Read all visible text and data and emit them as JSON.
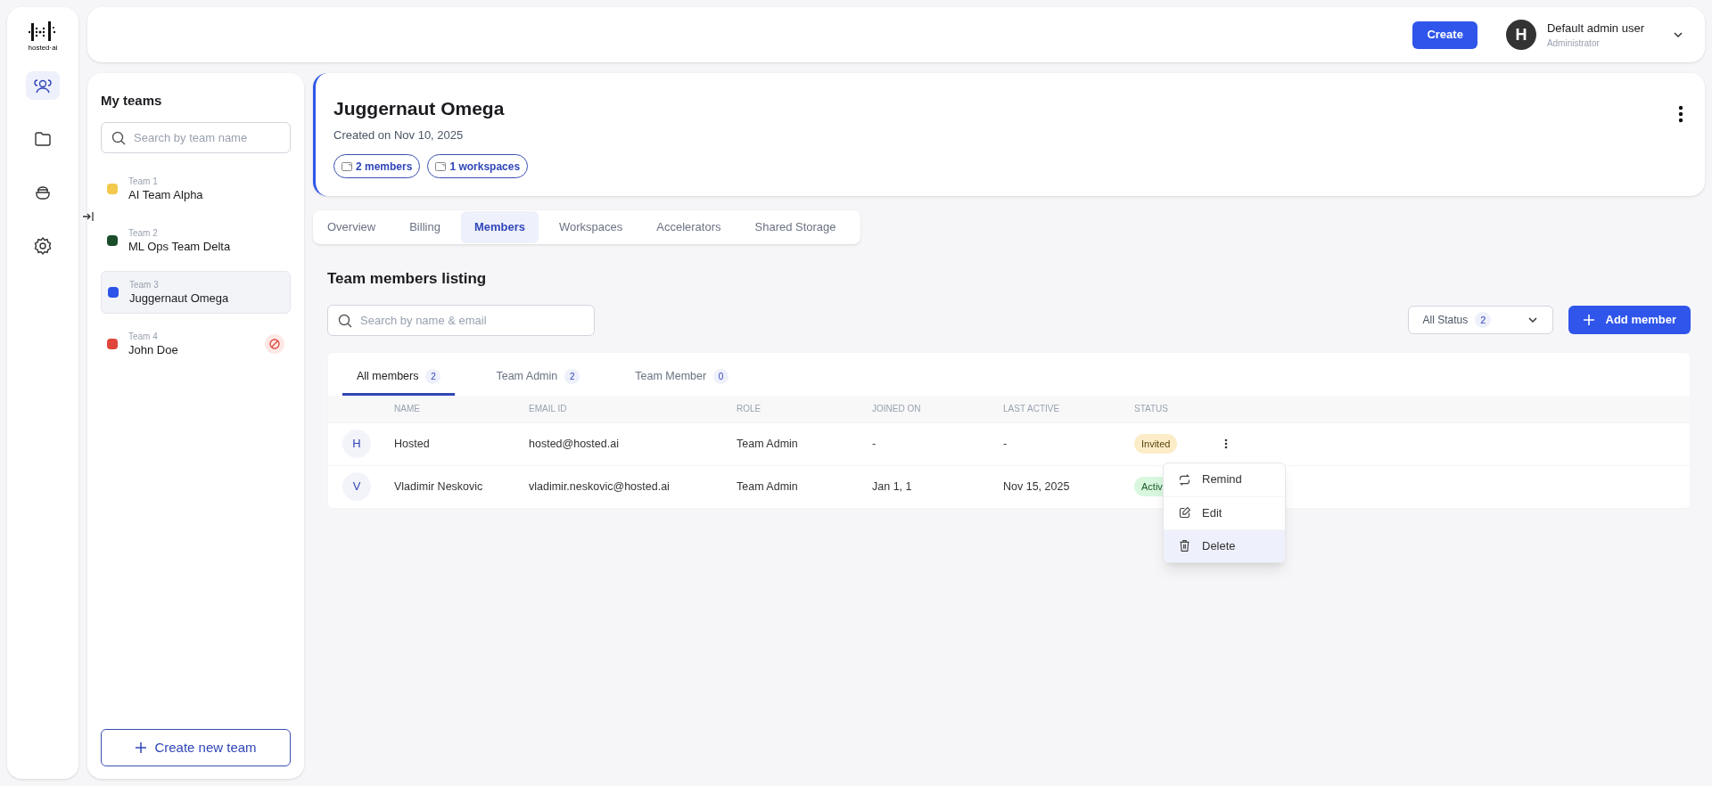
{
  "logo_text": "hosted·ai",
  "nav": [
    {
      "kind": "team",
      "selected": true
    },
    {
      "kind": "folder",
      "selected": false
    },
    {
      "kind": "bowl",
      "selected": false
    },
    {
      "kind": "settings",
      "selected": false
    }
  ],
  "header": {
    "create_button": "Create",
    "user": {
      "initial": "H",
      "name": "Default admin user",
      "role": "Administrator"
    }
  },
  "teams_panel": {
    "title": "My teams",
    "search": {
      "placeholder": "Search by team name"
    },
    "teams": [
      {
        "label": "Team 1",
        "name": "AI Team Alpha",
        "color": "#f2c94c",
        "selected": false,
        "blocked": false
      },
      {
        "label": "Team 2",
        "name": "ML Ops Team Delta",
        "color": "#1b4d2b",
        "selected": false,
        "blocked": false
      },
      {
        "label": "Team 3",
        "name": "Juggernaut Omega",
        "color": "#2d54e8",
        "selected": true,
        "blocked": false
      },
      {
        "label": "Team 4",
        "name": "John Doe",
        "color": "#e0443a",
        "selected": false,
        "blocked": true
      }
    ],
    "create_button": "Create new team"
  },
  "team_header": {
    "title": "Juggernaut Omega",
    "created": "Created on Nov 10, 2025",
    "chips": [
      "2 members",
      "1 workspaces"
    ]
  },
  "tabs": [
    {
      "label": "Overview",
      "selected": false
    },
    {
      "label": "Billing",
      "selected": false
    },
    {
      "label": "Members",
      "selected": true
    },
    {
      "label": "Workspaces",
      "selected": false
    },
    {
      "label": "Accelerators",
      "selected": false
    },
    {
      "label": "Shared Storage",
      "selected": false
    }
  ],
  "members": {
    "title": "Team members listing",
    "search": {
      "placeholder": "Search by name & email"
    },
    "status_filter": {
      "label": "All Status",
      "count": "2"
    },
    "add_button": "Add member",
    "subtabs": [
      {
        "label": "All members",
        "count": "2",
        "selected": true
      },
      {
        "label": "Team Admin",
        "count": "2",
        "selected": false
      },
      {
        "label": "Team Member",
        "count": "0",
        "selected": false
      }
    ],
    "columns": [
      "NAME",
      "EMAIL ID",
      "ROLE",
      "JOINED ON",
      "LAST ACTIVE",
      "STATUS"
    ],
    "rows": [
      {
        "initial": "H",
        "name": "Hosted",
        "email": "hosted@hosted.ai",
        "role": "Team Admin",
        "joined": "-",
        "last_active": "-",
        "status": "Invited",
        "kind": "invited"
      },
      {
        "initial": "V",
        "name": "Vladimir Neskovic",
        "email": "vladimir.neskovic@hosted.ai",
        "role": "Team Admin",
        "joined": "Jan 1, 1",
        "last_active": "Nov 15, 2025",
        "status": "Activ",
        "kind": "active"
      }
    ],
    "menu": [
      {
        "kind": "remind",
        "label": "Remind",
        "selected": false
      },
      {
        "kind": "edit",
        "label": "Edit",
        "selected": false
      },
      {
        "kind": "delete",
        "label": "Delete",
        "selected": true
      }
    ]
  }
}
